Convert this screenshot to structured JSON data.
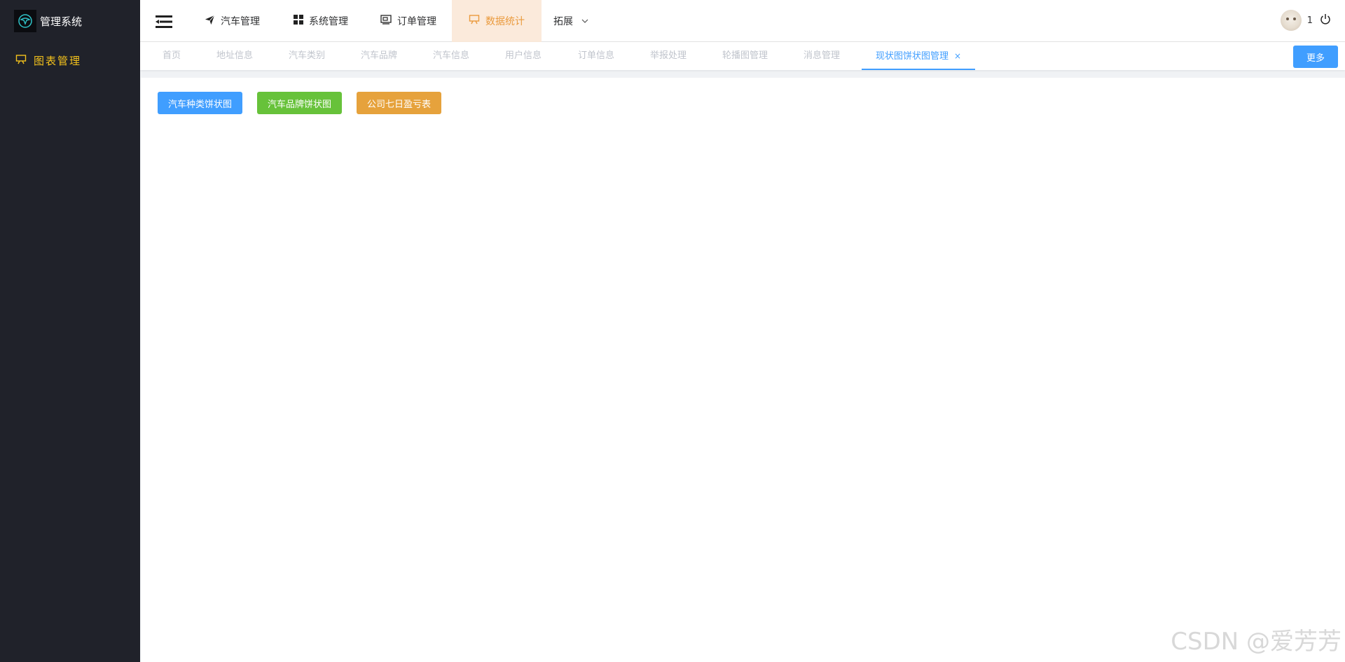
{
  "app": {
    "title": "管理系统"
  },
  "sidebar": {
    "items": [
      {
        "label": "图表管理",
        "icon": "chart-board-icon"
      }
    ]
  },
  "header": {
    "nav": [
      {
        "label": "汽车管理",
        "icon": "paper-plane-icon"
      },
      {
        "label": "系统管理",
        "icon": "grid-icon"
      },
      {
        "label": "订单管理",
        "icon": "order-icon"
      },
      {
        "label": "数据统计",
        "icon": "chart-board-icon",
        "active": true
      },
      {
        "label": "拓展",
        "icon": "chevron-down-icon"
      }
    ],
    "user": {
      "count": "1"
    }
  },
  "tags": {
    "items": [
      "首页",
      "地址信息",
      "汽车类别",
      "汽车品牌",
      "汽车信息",
      "用户信息",
      "订单信息",
      "举报处理",
      "轮播图管理",
      "消息管理"
    ],
    "active": "现状图饼状图管理",
    "close": "×",
    "more": "更多"
  },
  "main": {
    "buttons": [
      "汽车种类饼状图",
      "汽车品牌饼状图",
      "公司七日盈亏表"
    ]
  },
  "watermark": "CSDN @爱芳芳",
  "colors": {
    "primary": "#409eff",
    "success": "#67c23a",
    "warning": "#e6a23c",
    "sidebar": "#20222a",
    "sidebar_active": "#f4c21c",
    "nav_active_bg": "#fbeadb",
    "nav_active_text": "#ea9a3d"
  }
}
